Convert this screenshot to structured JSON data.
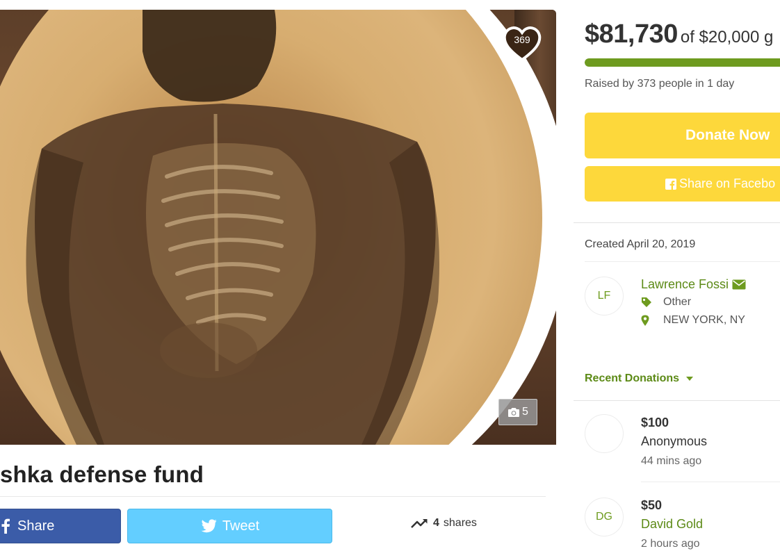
{
  "hero": {
    "heart_count": "369",
    "photo_count": "5"
  },
  "campaign": {
    "title": "shka defense fund"
  },
  "social": {
    "share_label": "Share",
    "tweet_label": "Tweet",
    "shares_number": "4",
    "shares_word": "shares"
  },
  "funding": {
    "raised": "$81,730",
    "goal_text": "of $20,000 g",
    "progress_fraction": 1.0,
    "raised_by": "Raised by 373 people in 1 day",
    "donate_label": "Donate Now",
    "facebook_label": "Share on Facebo"
  },
  "info": {
    "created": "Created April 20, 2019"
  },
  "organizer": {
    "initials": "LF",
    "name": "Lawrence Fossi",
    "category": "Other",
    "location": "NEW YORK, NY"
  },
  "recent": {
    "header": "Recent Donations",
    "donations": [
      {
        "initials": "",
        "amount": "$100",
        "name": "Anonymous",
        "time": "44 mins ago"
      },
      {
        "initials": "DG",
        "amount": "$50",
        "name": "David Gold",
        "time": "2 hours ago"
      }
    ]
  },
  "colors": {
    "accent_green": "#6e9b1f",
    "donate_yellow": "#fdd83b",
    "facebook_blue": "#3b5ca8",
    "twitter_blue": "#63ceff"
  },
  "icons": [
    "heart-icon",
    "camera-icon",
    "facebook-icon",
    "twitter-icon",
    "trending-icon",
    "envelope-icon",
    "tag-icon",
    "map-pin-icon",
    "caret-down-icon"
  ]
}
